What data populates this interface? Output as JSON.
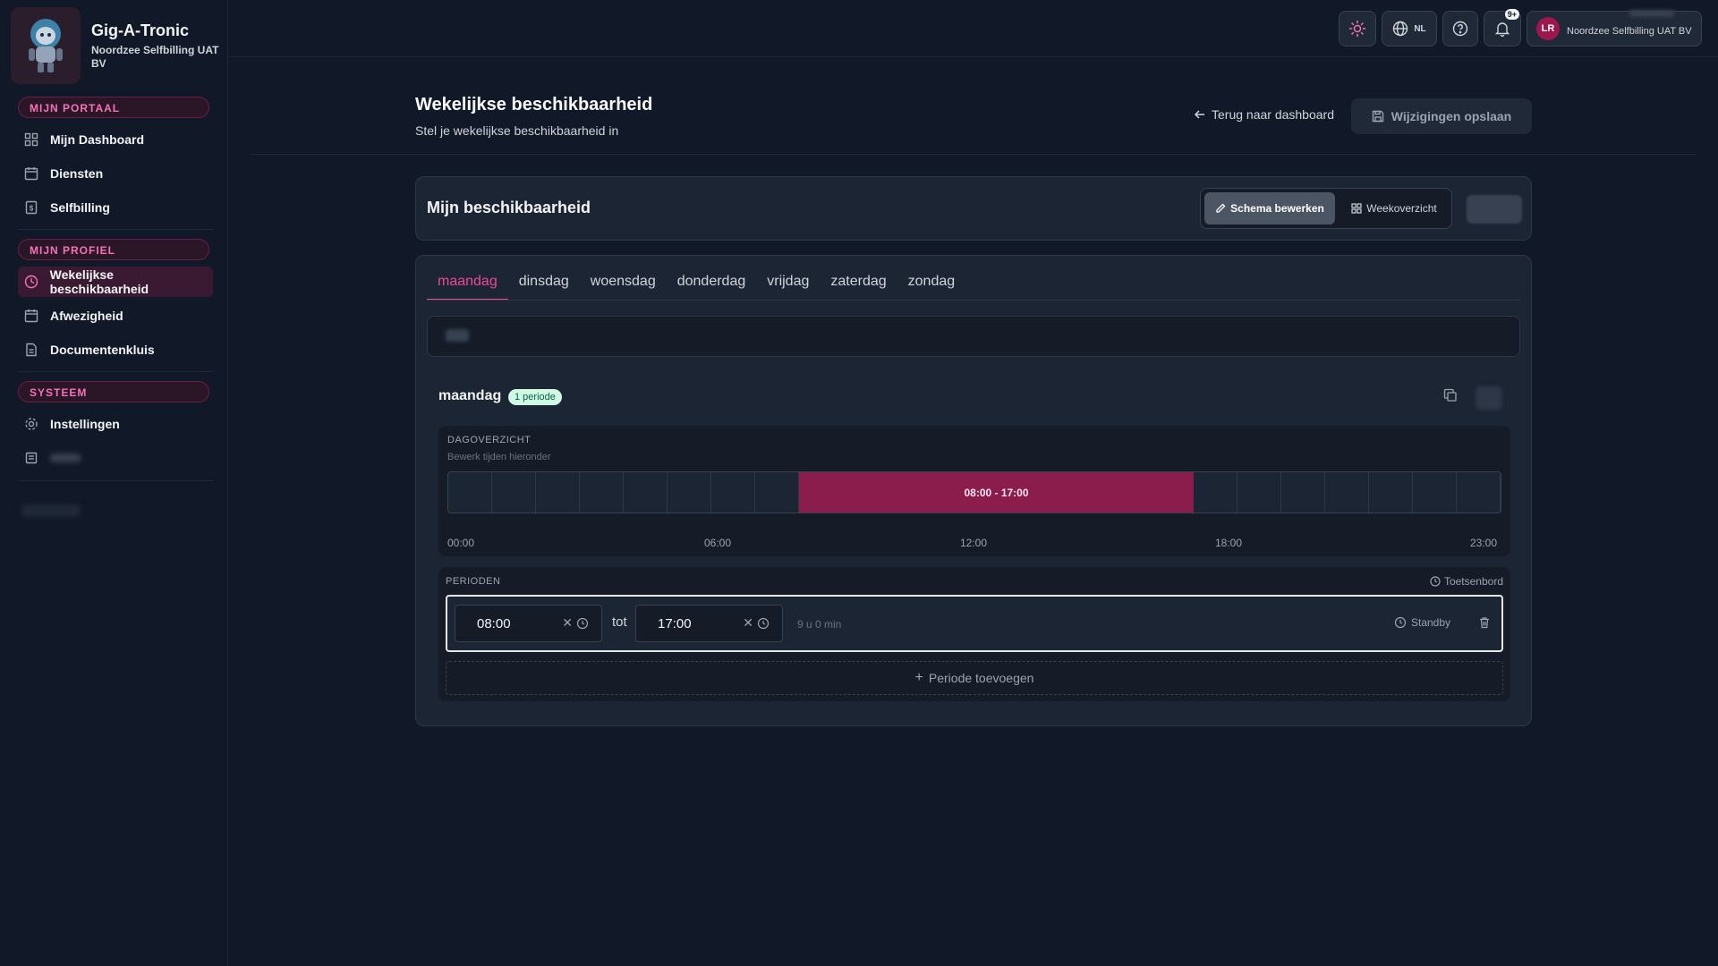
{
  "brand": {
    "title": "Gig-A-Tronic",
    "subtitle": "Noordzee Selfbilling UAT BV"
  },
  "sidebar": {
    "sections": [
      {
        "label": "MIJN PORTAAL"
      },
      {
        "label": "MIJN PROFIEL"
      },
      {
        "label": "SYSTEEM"
      }
    ],
    "items": [
      {
        "label": "Mijn Dashboard",
        "icon": "dashboard-icon"
      },
      {
        "label": "Diensten",
        "icon": "calendar-icon"
      },
      {
        "label": "Selfbilling",
        "icon": "invoice-icon"
      },
      {
        "label": "Wekelijkse beschikbaarheid",
        "icon": "clock-icon",
        "active": true
      },
      {
        "label": "Afwezigheid",
        "icon": "calendar-icon"
      },
      {
        "label": "Documentenkluis",
        "icon": "document-icon"
      },
      {
        "label": "Instellingen",
        "icon": "gear-icon"
      }
    ]
  },
  "topbar": {
    "language": "NL",
    "notification_count": "9+",
    "user_initials": "LR",
    "user_org": "Noordzee Selfbilling UAT BV"
  },
  "header": {
    "title": "Wekelijkse beschikbaarheid",
    "subtitle": "Stel je wekelijkse beschikbaarheid in",
    "back_label": "Terug naar dashboard",
    "save_label": "Wijzigingen opslaan"
  },
  "availability": {
    "title": "Mijn beschikbaarheid",
    "edit_label": "Schema bewerken",
    "week_label": "Weekoverzicht"
  },
  "tabs": [
    "maandag",
    "dinsdag",
    "woensdag",
    "donderdag",
    "vrijdag",
    "zaterdag",
    "zondag"
  ],
  "day": {
    "name": "maandag",
    "period_badge": "1 periode",
    "overview_label": "DAGOVERZICHT",
    "overview_sub": "Bewerk tijden hieronder",
    "range_label": "08:00 - 17:00",
    "range_start_hour": 8,
    "range_end_hour": 17,
    "ticks": [
      "00:00",
      "06:00",
      "12:00",
      "18:00",
      "23:00"
    ]
  },
  "periods": {
    "label": "PERIODEN",
    "keyboard_label": "Toetsenbord",
    "start": "08:00",
    "separator": "tot",
    "end": "17:00",
    "duration": "9 u 0 min",
    "standby_label": "Standby",
    "add_label": "Periode toevoegen"
  },
  "colors": {
    "accent": "#ec4899",
    "range": "#8b1d4d",
    "background": "#111827"
  }
}
